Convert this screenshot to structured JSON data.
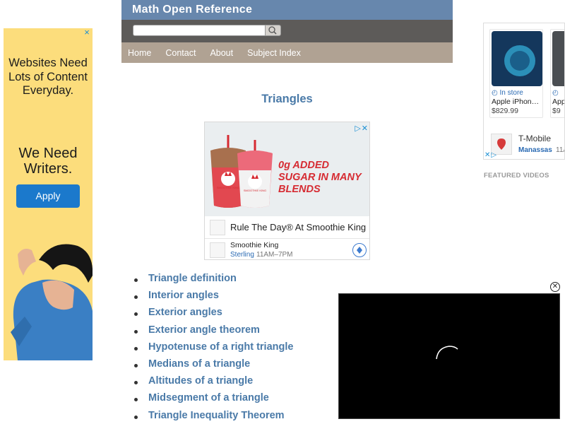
{
  "left_ad": {
    "close": "×",
    "headline": "Websites Need Lots of Content Everyday.",
    "subhead": "We Need Writers.",
    "button": "Apply"
  },
  "header": {
    "title": "Math Open Reference",
    "search": {
      "placeholder": ""
    },
    "nav": [
      "Home",
      "Contact",
      "About",
      "Subject Index"
    ]
  },
  "page": {
    "title": "Triangles"
  },
  "center_ad": {
    "slogan": "0g ADDED SUGAR IN MANY BLENDS",
    "promo": "Rule The Day® At Smoothie King",
    "business": "Smoothie King",
    "location": "Sterling",
    "hours": "11AM–7PM",
    "brand_mark": "SMOOTHIE KING"
  },
  "topics": [
    "Triangle definition",
    "Interior angles",
    "Exterior angles",
    "Exterior angle theorem",
    "Hypotenuse of a right triangle",
    "Medians of a triangle",
    "Altitudes of a triangle",
    "Midsegment of a triangle",
    "Triangle Inequality Theorem"
  ],
  "right_ad": {
    "products": [
      {
        "availability": "In store",
        "name": "Apple iPhon…",
        "price": "$829.99"
      },
      {
        "availability": "",
        "name": "App",
        "price": "$9"
      }
    ],
    "store_name": "T-Mobile",
    "store_location": "Manassas",
    "store_hours": "11A"
  },
  "featured_label": "FEATURED VIDEOS",
  "video": {
    "close": "⊗"
  },
  "colors": {
    "title_bar": "#6787ad",
    "search_bar": "#5d5b59",
    "nav_bar": "#b0a293",
    "link": "#4a7aa8",
    "left_ad_bg": "#fcdd7c",
    "apply_button": "#1b79cc",
    "slogan_red": "#d62b32"
  }
}
